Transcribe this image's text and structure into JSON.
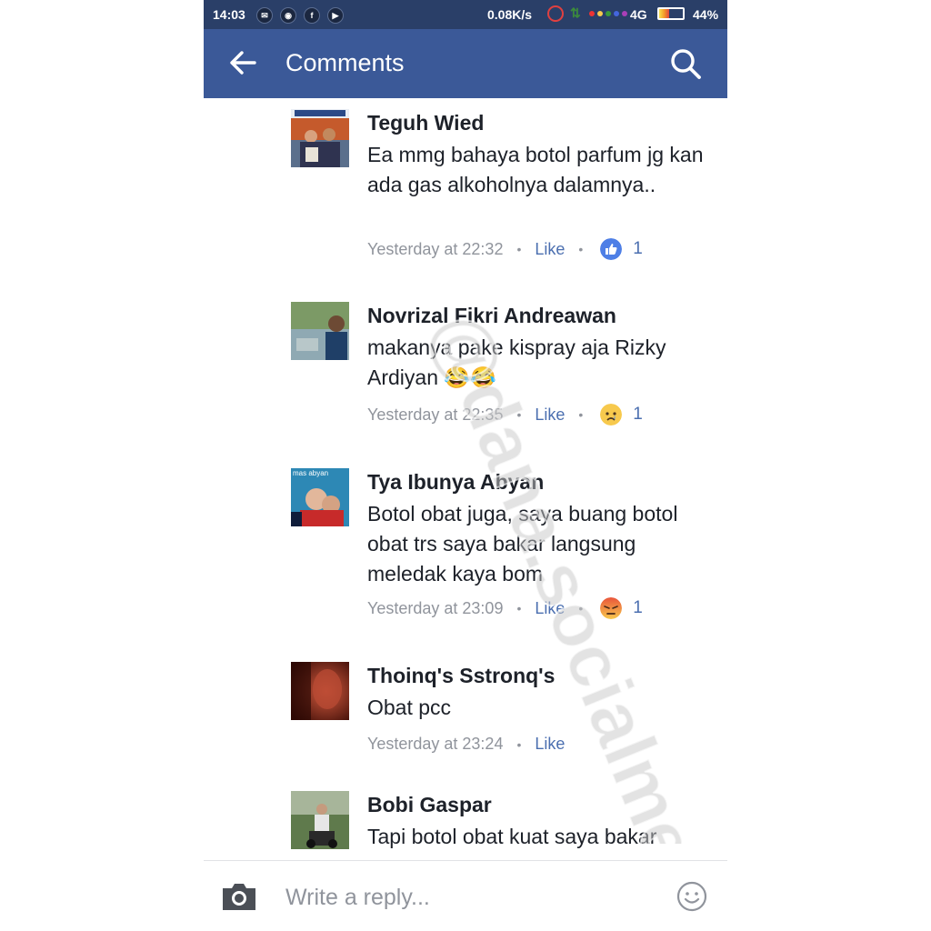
{
  "status_bar": {
    "time": "14:03",
    "notification_icons": [
      "messenger-icon",
      "android-icon",
      "facebook-icon",
      "youtube-icon"
    ],
    "network_speed": "0.08K/s",
    "network_type": "4G",
    "battery_percent": "44%",
    "battery_level": 0.44
  },
  "app_bar": {
    "title": "Comments",
    "background_color": "#3b5998"
  },
  "comments": [
    {
      "author": "Teguh Wied",
      "text": "Ea mmg bahaya botol parfum jg kan ada gas alkoholnya dalamnya..",
      "timestamp": "Yesterday at 22:32",
      "like_label": "Like",
      "reaction": "like-reaction-icon",
      "reaction_count": "1"
    },
    {
      "author": "Novrizal Fikri Andreawan",
      "text": "makanya pake kispray aja Rizky Ardiyan 😂😂",
      "timestamp": "Yesterday at 22:35",
      "like_label": "Like",
      "reaction": "sad-reaction-icon",
      "reaction_count": "1"
    },
    {
      "author": "Tya Ibunya Abyan",
      "text": "Botol obat juga, saya buang botol obat trs saya bakar langsung meledak kaya bom",
      "avatar_text": "mas abyan",
      "timestamp": "Yesterday at 23:09",
      "like_label": "Like",
      "reaction": "angry-reaction-icon",
      "reaction_count": "1"
    },
    {
      "author": "Thoinq's Sstronq's",
      "text": "Obat pcc",
      "timestamp": "Yesterday at 23:24",
      "like_label": "Like"
    },
    {
      "author": "Bobi Gaspar",
      "text": "Tapi botol obat kuat saya bakar"
    }
  ],
  "reply_bar": {
    "placeholder": "Write a reply..."
  },
  "watermark": "@dana.socialmedia"
}
